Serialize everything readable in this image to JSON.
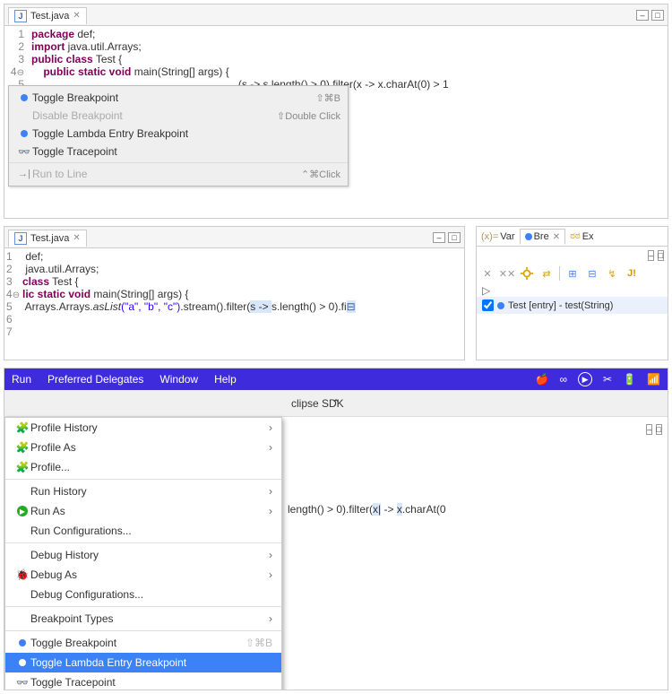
{
  "colors": {
    "keyword": "#7f0055",
    "string": "#2a00ff",
    "selection": "#d8e6fc",
    "menubar": "#3d2bdc",
    "highlight": "#3b82f6"
  },
  "editor_top": {
    "tab_title": "Test.java",
    "lines": {
      "1": {
        "num": "1",
        "prefix": "package",
        "rest": " def;"
      },
      "2": {
        "num": "2",
        "prefix": "import",
        "rest": " java.util.Arrays;"
      },
      "3": {
        "num": "3",
        "prefix": "public class",
        "rest": " Test {"
      },
      "4": {
        "num": "4",
        "gutter": "⊖",
        "prefix": "    public static void",
        "mid": " main(String[] args) {"
      },
      "5": {
        "num": "5",
        "indent": "        ",
        "frag": "(s -> s.length() > 0).filter(x -> x.charAt(0) > 1"
      }
    }
  },
  "context_menu": {
    "items": {
      "toggle_bp": {
        "label": "Toggle Breakpoint",
        "shortcut": "⇧⌘B"
      },
      "disable_bp": {
        "label": "Disable Breakpoint",
        "shortcut": "⇧Double Click"
      },
      "toggle_lambda": {
        "label": "Toggle Lambda Entry Breakpoint"
      },
      "toggle_trace": {
        "label": "Toggle Tracepoint"
      },
      "run_to_line": {
        "label": "Run to Line",
        "shortcut": "⌃⌘Click"
      }
    }
  },
  "editor_mid": {
    "tab_title": "Test.java",
    "lines": {
      "1": {
        "num": "1",
        "text": " def;"
      },
      "2": {
        "num": "2",
        "text": " java.util.Arrays;"
      },
      "3": {
        "num": "3",
        "prefix": "class",
        "rest": " Test {"
      },
      "4": {
        "num": "4",
        "gutter": "⊖",
        "prefix": "lic static void",
        "mid": " main(String[] args) {"
      },
      "5": {
        "num": "5",
        "indent": " Arrays.",
        "aslist": "asList",
        "args": "(\"a\", \"b\", \"c\")",
        "tail1": ".stream().filter(",
        "lamb": "s -> ",
        "tail2": "s.length() > 0).fi",
        "box": "⊟"
      },
      "6": {
        "num": "6"
      },
      "7": {
        "num": "7"
      }
    }
  },
  "breakpoints_view": {
    "tabs": {
      "var": "Var",
      "bre": "Bre",
      "ex": "Ex"
    },
    "toolbar_icons": {
      "remove": "✕",
      "remove_all": "✕✕",
      "settings": "⚙",
      "link": "⇄",
      "expand": "⊞",
      "collapse": "⊟",
      "skip": "↯",
      "jbtn": "J!"
    },
    "tree": {
      "expand": "▷"
    },
    "entry": {
      "label": "Test [entry] - test(String)"
    }
  },
  "menubar": {
    "items": {
      "run": "Run",
      "pref": "Preferred Delegates",
      "window": "Window",
      "help": "Help"
    },
    "title_frag": "clipse SDK"
  },
  "dropdown": {
    "items": {
      "profile_history": {
        "label": "Profile History"
      },
      "profile_as": {
        "label": "Profile As"
      },
      "profile": {
        "label": "Profile..."
      },
      "run_history": {
        "label": "Run History"
      },
      "run_as": {
        "label": "Run As"
      },
      "run_config": {
        "label": "Run Configurations..."
      },
      "debug_history": {
        "label": "Debug History"
      },
      "debug_as": {
        "label": "Debug As"
      },
      "debug_config": {
        "label": "Debug Configurations..."
      },
      "breakpoint_types": {
        "label": "Breakpoint Types"
      },
      "toggle_bp": {
        "label": "Toggle Breakpoint",
        "shortcut": "⇧⌘B"
      },
      "toggle_lambda": {
        "label": "Toggle Lambda Entry Breakpoint"
      },
      "toggle_trace": {
        "label": "Toggle Tracepoint"
      }
    }
  },
  "editor_bot_frag": {
    "text": "length() > 0).filter(x| -> x.charAt(0"
  }
}
